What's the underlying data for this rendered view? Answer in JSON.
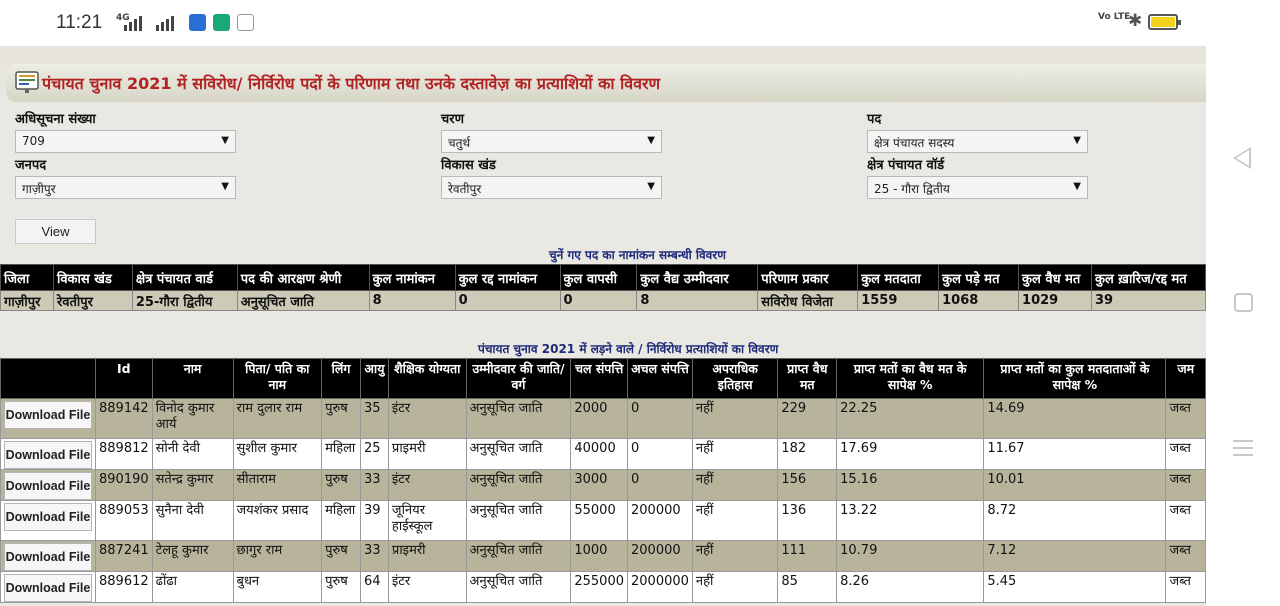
{
  "status_bar": {
    "time": "11:21",
    "network": "4G",
    "right_label": "Vo LTE",
    "battery_color": "#f2d21b"
  },
  "page": {
    "title": "पंचायत चुनाव 2021 में सविरोध/ निर्विरोध पदों के परिणाम तथा उनके दस्तावेज़ का प्रत्याशियों का विवरण",
    "form": {
      "notification_label": "अधिसूचना संख्या",
      "notification_value": "709",
      "phase_label": "चरण",
      "phase_value": "चतुर्थ",
      "post_label": "पद",
      "post_value": "क्षेत्र पंचायत सदस्य",
      "district_label": "जनपद",
      "district_value": "गाज़ीपुर",
      "block_label": "विकास खंड",
      "block_value": "रेवतीपुर",
      "ward_label": "क्षेत्र पंचायत वॉर्ड",
      "ward_value": "25 - गौरा द्वितीय",
      "view_button": "View"
    },
    "nomination_section_title": "चुनें गए पद का नामांकन सम्बन्धी विवरण",
    "nomination_table": {
      "headers": [
        "जिला",
        "विकास खंड",
        "क्षेत्र पंचायत वार्ड",
        "पद की आरक्षण श्रेणी",
        "कुल नामांकन",
        "कुल रद्द नामांकन",
        "कुल वापसी",
        "कुल वैद्य उम्मीदवार",
        "परिणाम प्रकार",
        "कुल मतदाता",
        "कुल पड़े मत",
        "कुल वैध मत",
        "कुल ख़ारिज/रद्द मत"
      ],
      "row": [
        "गाज़ीपुर",
        "रेवतीपुर",
        "25-गौरा द्वितीय",
        "अनुसूचित जाति",
        "8",
        "0",
        "0",
        "8",
        "सविरोध विजेता",
        "1559",
        "1068",
        "1029",
        "39"
      ]
    },
    "candidates_section_title": "पंचायत चुनाव 2021 में लड़ने वाले / निर्विरोध प्रत्याशियों का विवरण",
    "candidates_table": {
      "headers": [
        "",
        "Id",
        "नाम",
        "पिता/ पति का नाम",
        "लिंग",
        "आयु",
        "शैक्षिक योग्यता",
        "उम्मीदवार की जाति/वर्ग",
        "चल संपत्ति",
        "अचल संपत्ति",
        "अपराधिक इतिहास",
        "प्राप्त वैध मत",
        "प्राप्त मतों का वैध मत के सापेक्ष %",
        "प्राप्त मतों का कुल मतदाताओं के सापेक्ष %",
        "जम"
      ],
      "download_label": "Download File",
      "rows": [
        {
          "id": "889142",
          "name": "विनोद कुमार आर्य",
          "father": "राम दुलार राम",
          "gender": "पुरुष",
          "age": "35",
          "education": "इंटर",
          "caste": "अनुसूचित जाति",
          "movable": "2000",
          "immovable": "0",
          "criminal": "नहीं",
          "votes": "229",
          "pct_valid": "22.25",
          "pct_total": "14.69",
          "deposit": "जब्त"
        },
        {
          "id": "889812",
          "name": "सोनी देवी",
          "father": "सुशील कुमार",
          "gender": "महिला",
          "age": "25",
          "education": "प्राइमरी",
          "caste": "अनुसूचित जाति",
          "movable": "40000",
          "immovable": "0",
          "criminal": "नहीं",
          "votes": "182",
          "pct_valid": "17.69",
          "pct_total": "11.67",
          "deposit": "जब्त"
        },
        {
          "id": "890190",
          "name": "सतेन्द्र कुमार",
          "father": "सीताराम",
          "gender": "पुरुष",
          "age": "33",
          "education": "इंटर",
          "caste": "अनुसूचित जाति",
          "movable": "3000",
          "immovable": "0",
          "criminal": "नहीं",
          "votes": "156",
          "pct_valid": "15.16",
          "pct_total": "10.01",
          "deposit": "जब्त"
        },
        {
          "id": "889053",
          "name": "सुनैना देवी",
          "father": "जयशंकर प्रसाद",
          "gender": "महिला",
          "age": "39",
          "education": "जूनियर हाईस्कूल",
          "caste": "अनुसूचित जाति",
          "movable": "55000",
          "immovable": "200000",
          "criminal": "नहीं",
          "votes": "136",
          "pct_valid": "13.22",
          "pct_total": "8.72",
          "deposit": "जब्त"
        },
        {
          "id": "887241",
          "name": "टेलहू कुमार",
          "father": "छागुर राम",
          "gender": "पुरुष",
          "age": "33",
          "education": "प्राइमरी",
          "caste": "अनुसूचित जाति",
          "movable": "1000",
          "immovable": "200000",
          "criminal": "नहीं",
          "votes": "111",
          "pct_valid": "10.79",
          "pct_total": "7.12",
          "deposit": "जब्त"
        },
        {
          "id": "889612",
          "name": "ढोंढा",
          "father": "बुधन",
          "gender": "पुरुष",
          "age": "64",
          "education": "इंटर",
          "caste": "अनुसूचित जाति",
          "movable": "255000",
          "immovable": "2000000",
          "criminal": "नहीं",
          "votes": "85",
          "pct_valid": "8.26",
          "pct_total": "5.45",
          "deposit": "जब्त"
        }
      ]
    }
  }
}
